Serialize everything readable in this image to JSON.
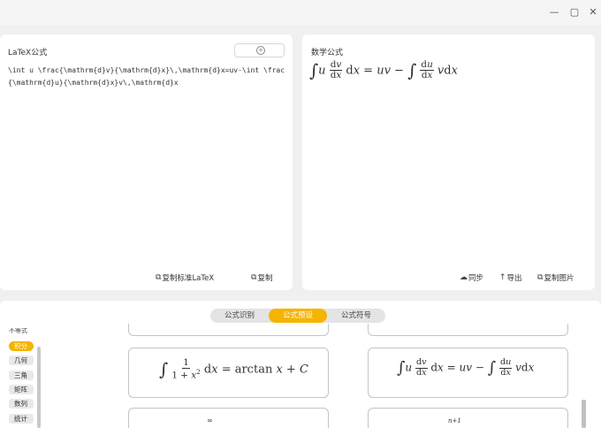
{
  "window": {
    "minimize_icon": "—",
    "maximize_icon": "▢",
    "close_icon": "✕"
  },
  "latex_panel": {
    "title": "LaTeX公式",
    "add_icon": "+",
    "latex_source": "\\int u \\frac{\\mathrm{d}v}{\\mathrm{d}x}\\,\\mathrm{d}x=uv-\\int \\frac{\\mathrm{d}u}{\\mathrm{d}x}v\\,\\mathrm{d}x",
    "copy_standard_label": "复制标准LaTeX",
    "copy_label": "复制"
  },
  "math_panel": {
    "title": "数学公式",
    "sync_label": "同步",
    "export_label": "导出",
    "copy_image_label": "复制图片"
  },
  "tabs": [
    {
      "label": "公式识别",
      "active": false
    },
    {
      "label": "公式预设",
      "active": true
    },
    {
      "label": "公式符号",
      "active": false
    }
  ],
  "sidebar": {
    "partial_top": "不等式",
    "items": [
      {
        "label": "积分",
        "active": true
      },
      {
        "label": "几何",
        "active": false
      },
      {
        "label": "三角",
        "active": false
      },
      {
        "label": "矩阵",
        "active": false
      },
      {
        "label": "数列",
        "active": false
      },
      {
        "label": "统计",
        "active": false
      }
    ]
  },
  "presets": {
    "card1": {
      "one": "1",
      "one_plus": "1 + ",
      "x": "x",
      "two": "2",
      "dx": "d",
      "x2": "x",
      "eq": " = arctan ",
      "x3": "x",
      "plus": " + ",
      "C": "C"
    },
    "card2": {
      "u": "u",
      "d1": "d",
      "v1": "v",
      "d2": "d",
      "x1": "x",
      "dx": "d",
      "x2": "x",
      "eq": " = ",
      "uv": "uv",
      "minus": " − ",
      "d3": "d",
      "u2": "u",
      "d4": "d",
      "x3": "x",
      "v2": "v",
      "dx2": "d",
      "x4": "x"
    },
    "card3_partial": {
      "infinity": "∞"
    },
    "card4_partial": {
      "exponent": "n+1"
    }
  },
  "colors": {
    "accent": "#f4b400",
    "panel": "#ffffff",
    "background": "#f0f0f0"
  }
}
